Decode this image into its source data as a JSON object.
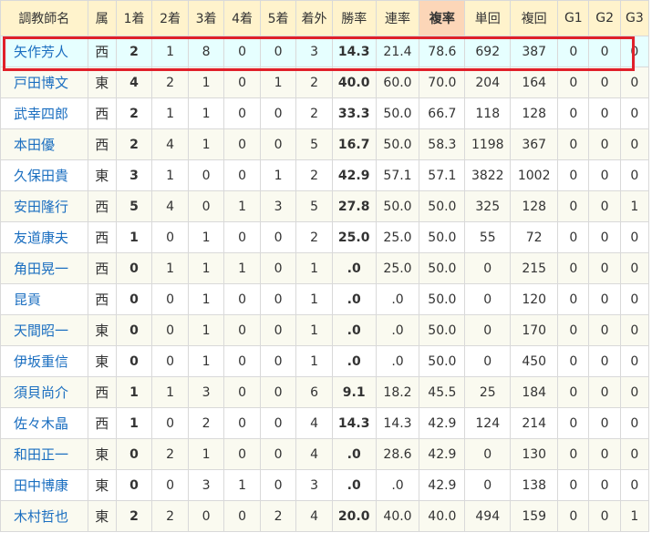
{
  "headers": [
    "調教師名",
    "属",
    "1着",
    "2着",
    "3着",
    "4着",
    "5着",
    "着外",
    "勝率",
    "連率",
    "複率",
    "単回",
    "複回",
    "G1",
    "G2",
    "G3"
  ],
  "rows": [
    [
      "矢作芳人",
      "西",
      "2",
      "1",
      "8",
      "0",
      "0",
      "3",
      "14.3",
      "21.4",
      "78.6",
      "692",
      "387",
      "0",
      "0",
      "0"
    ],
    [
      "戸田博文",
      "東",
      "4",
      "2",
      "1",
      "0",
      "1",
      "2",
      "40.0",
      "60.0",
      "70.0",
      "204",
      "164",
      "0",
      "0",
      "0"
    ],
    [
      "武幸四郎",
      "西",
      "2",
      "1",
      "1",
      "0",
      "0",
      "2",
      "33.3",
      "50.0",
      "66.7",
      "118",
      "128",
      "0",
      "0",
      "0"
    ],
    [
      "本田優",
      "西",
      "2",
      "4",
      "1",
      "0",
      "0",
      "5",
      "16.7",
      "50.0",
      "58.3",
      "1198",
      "367",
      "0",
      "0",
      "0"
    ],
    [
      "久保田貴",
      "東",
      "3",
      "1",
      "0",
      "0",
      "1",
      "2",
      "42.9",
      "57.1",
      "57.1",
      "3822",
      "1002",
      "0",
      "0",
      "0"
    ],
    [
      "安田隆行",
      "西",
      "5",
      "4",
      "0",
      "1",
      "3",
      "5",
      "27.8",
      "50.0",
      "50.0",
      "325",
      "128",
      "0",
      "0",
      "1"
    ],
    [
      "友道康夫",
      "西",
      "1",
      "0",
      "1",
      "0",
      "0",
      "2",
      "25.0",
      "25.0",
      "50.0",
      "55",
      "72",
      "0",
      "0",
      "0"
    ],
    [
      "角田晃一",
      "西",
      "0",
      "1",
      "1",
      "1",
      "0",
      "1",
      ".0",
      "25.0",
      "50.0",
      "0",
      "215",
      "0",
      "0",
      "0"
    ],
    [
      "昆貢",
      "西",
      "0",
      "0",
      "1",
      "0",
      "0",
      "1",
      ".0",
      ".0",
      "50.0",
      "0",
      "120",
      "0",
      "0",
      "0"
    ],
    [
      "天間昭一",
      "東",
      "0",
      "0",
      "1",
      "0",
      "0",
      "1",
      ".0",
      ".0",
      "50.0",
      "0",
      "170",
      "0",
      "0",
      "0"
    ],
    [
      "伊坂重信",
      "東",
      "0",
      "0",
      "1",
      "0",
      "0",
      "1",
      ".0",
      ".0",
      "50.0",
      "0",
      "450",
      "0",
      "0",
      "0"
    ],
    [
      "須貝尚介",
      "西",
      "1",
      "1",
      "3",
      "0",
      "0",
      "6",
      "9.1",
      "18.2",
      "45.5",
      "25",
      "184",
      "0",
      "0",
      "0"
    ],
    [
      "佐々木晶",
      "西",
      "1",
      "0",
      "2",
      "0",
      "0",
      "4",
      "14.3",
      "14.3",
      "42.9",
      "124",
      "214",
      "0",
      "0",
      "0"
    ],
    [
      "和田正一",
      "東",
      "0",
      "2",
      "1",
      "0",
      "0",
      "4",
      ".0",
      "28.6",
      "42.9",
      "0",
      "130",
      "0",
      "0",
      "0"
    ],
    [
      "田中博康",
      "東",
      "0",
      "0",
      "3",
      "1",
      "0",
      "3",
      ".0",
      ".0",
      "42.9",
      "0",
      "138",
      "0",
      "0",
      "0"
    ],
    [
      "木村哲也",
      "東",
      "2",
      "2",
      "0",
      "0",
      "2",
      "4",
      "20.0",
      "40.0",
      "40.0",
      "494",
      "159",
      "0",
      "0",
      "1"
    ]
  ],
  "highlight_column": "複率",
  "selected_row": 0,
  "colors": {
    "header_bg": "#fff3cc",
    "highlight_header_bg": "#fcd6b8",
    "name_link": "#1a6ec0",
    "selected_row_bg": "#e6ffff",
    "selection_border": "#e0202a"
  }
}
